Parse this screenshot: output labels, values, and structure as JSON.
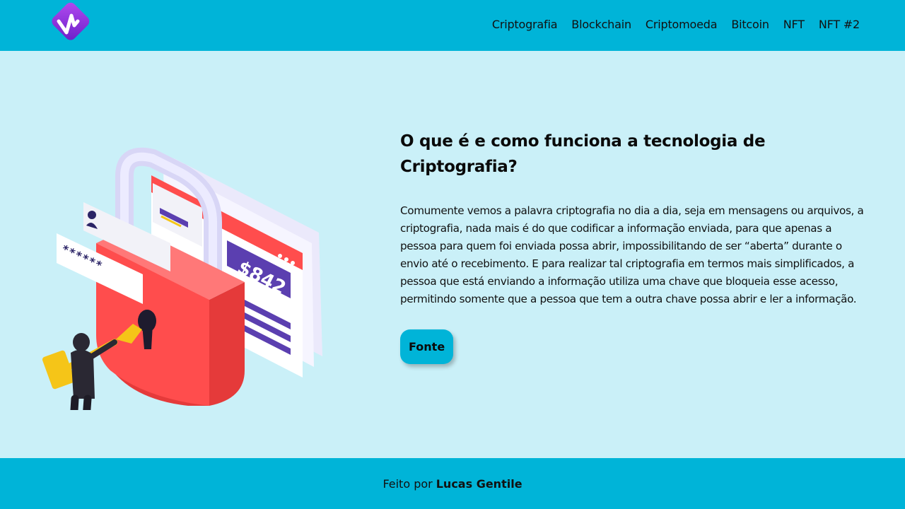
{
  "header": {
    "nav": [
      {
        "label": "Criptografia"
      },
      {
        "label": "Blockchain"
      },
      {
        "label": "Criptomoeda"
      },
      {
        "label": "Bitcoin"
      },
      {
        "label": "NFT"
      },
      {
        "label": "NFT #2"
      }
    ]
  },
  "main": {
    "title": "O que é e como funciona a tecnologia de Criptografia?",
    "paragraph": "Comumente vemos a palavra criptografia no dia a dia, seja em mensagens ou arquivos, a criptografia, nada mais é do que codificar a informação enviada, para que apenas a pessoa para quem foi enviada possa abrir, impossibilitando de ser “aberta” durante o envio até o recebimento. E para realizar tal criptografia em termos mais simplificados, a pessoa que está enviando a informação utiliza uma chave que bloqueia esse acesso, permitindo somente que a pessoa que tem a outra chave possa abrir e ler a informação.",
    "button_label": "Fonte",
    "illustration": {
      "price_text": "$842",
      "password_mask": "******"
    }
  },
  "footer": {
    "prefix": "Feito por",
    "author": "Lucas Gentile"
  },
  "colors": {
    "header_bg": "#00b4d8",
    "page_bg": "#caf0f8",
    "lock_red": "#ff4d4d",
    "accent_purple": "#5b3fb0"
  }
}
